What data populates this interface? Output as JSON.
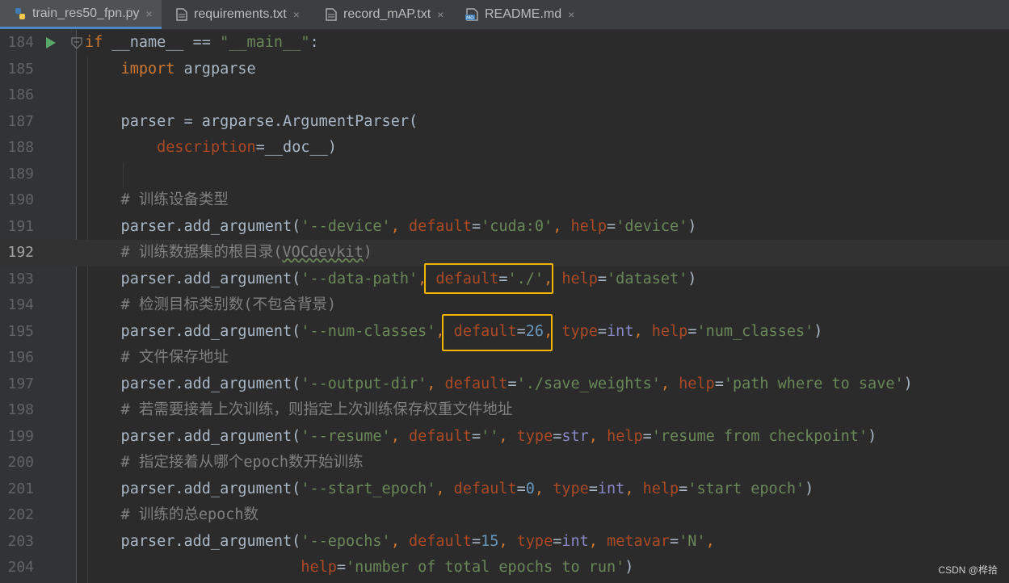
{
  "tabs": [
    {
      "label": "train_res50_fpn.py",
      "icon": "python-file-icon",
      "active": true
    },
    {
      "label": "requirements.txt",
      "icon": "text-file-icon",
      "active": false
    },
    {
      "label": "record_mAP.txt",
      "icon": "text-file-icon",
      "active": false
    },
    {
      "label": "README.md",
      "icon": "markdown-file-icon",
      "active": false
    }
  ],
  "close_glyph": "×",
  "current_line": 192,
  "lines": [
    {
      "num": "184",
      "code": "if __name__ == \"__main__\":"
    },
    {
      "num": "185",
      "code": "    import argparse"
    },
    {
      "num": "186",
      "code": ""
    },
    {
      "num": "187",
      "code": "    parser = argparse.ArgumentParser("
    },
    {
      "num": "188",
      "code": "        description=__doc__)"
    },
    {
      "num": "189",
      "code": ""
    },
    {
      "num": "190",
      "code": "    # 训练设备类型"
    },
    {
      "num": "191",
      "code": "    parser.add_argument('--device', default='cuda:0', help='device')"
    },
    {
      "num": "192",
      "code": "    # 训练数据集的根目录(VOCdevkit)"
    },
    {
      "num": "193",
      "code": "    parser.add_argument('--data-path', default='./', help='dataset')"
    },
    {
      "num": "194",
      "code": "    # 检测目标类别数(不包含背景)"
    },
    {
      "num": "195",
      "code": "    parser.add_argument('--num-classes', default=26, type=int, help='num_classes')"
    },
    {
      "num": "196",
      "code": "    # 文件保存地址"
    },
    {
      "num": "197",
      "code": "    parser.add_argument('--output-dir', default='./save_weights', help='path where to save')"
    },
    {
      "num": "198",
      "code": "    # 若需要接着上次训练，则指定上次训练保存权重文件地址"
    },
    {
      "num": "199",
      "code": "    parser.add_argument('--resume', default='', type=str, help='resume from checkpoint')"
    },
    {
      "num": "200",
      "code": "    # 指定接着从哪个epoch数开始训练"
    },
    {
      "num": "201",
      "code": "    parser.add_argument('--start_epoch', default=0, type=int, help='start epoch')"
    },
    {
      "num": "202",
      "code": "    # 训练的总epoch数"
    },
    {
      "num": "203",
      "code": "    parser.add_argument('--epochs', default=15, type=int, metavar='N',"
    },
    {
      "num": "204",
      "code": "                        help='number of total epochs to run')"
    }
  ],
  "watermark": "CSDN @桦拾",
  "colors": {
    "keyword": "#cc7832",
    "string": "#6a8759",
    "comment": "#808080",
    "number": "#6897bb",
    "parameter": "#aa4926",
    "builtin": "#8888c6",
    "highlight_box": "#f5b400"
  }
}
